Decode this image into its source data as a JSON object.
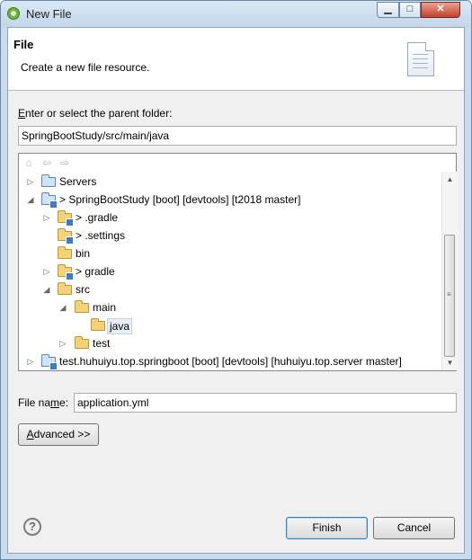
{
  "window": {
    "title": "New File",
    "controls": {
      "minimize": "▁",
      "maximize": "□",
      "close": "✕"
    }
  },
  "banner": {
    "title": "File",
    "description": "Create a new file resource."
  },
  "parent_folder": {
    "label_mnemonic": "E",
    "label_rest": "nter or select the parent folder:",
    "value": "SpringBootStudy/src/main/java"
  },
  "tree": {
    "toolbar": {
      "home": "⌂",
      "back": "⇦",
      "forward": "⇨"
    },
    "rows": [
      {
        "text": "Servers",
        "expander": "▷",
        "kind": "project"
      },
      {
        "text": "> SpringBootStudy [boot] [devtools] [t2018 master]",
        "expander": "◢",
        "kind": "project"
      },
      {
        "text": "> .gradle",
        "expander": "▷",
        "kind": "folder"
      },
      {
        "text": "> .settings",
        "expander": "",
        "kind": "folder"
      },
      {
        "text": "bin",
        "expander": "",
        "kind": "folder"
      },
      {
        "text": "> gradle",
        "expander": "▷",
        "kind": "folder"
      },
      {
        "text": "src",
        "expander": "◢",
        "kind": "folder"
      },
      {
        "text": "main",
        "expander": "◢",
        "kind": "folder"
      },
      {
        "text": "java",
        "expander": "",
        "kind": "folder",
        "selected": true
      },
      {
        "text": "test",
        "expander": "▷",
        "kind": "folder"
      },
      {
        "text": "test.huhuiyu.top.springboot [boot] [devtools] [huhuiyu.top.server master]",
        "expander": "▷",
        "kind": "project"
      }
    ],
    "scroll": {
      "up": "▲",
      "down": "▼",
      "grip": "≡"
    }
  },
  "file_name": {
    "label_before": "File na",
    "label_mnemonic": "m",
    "label_after": "e:",
    "value": "application.yml"
  },
  "advanced": {
    "mnemonic": "A",
    "rest": "dvanced >>"
  },
  "help": {
    "glyph": "?"
  },
  "buttons": {
    "finish": "Finish",
    "cancel": "Cancel"
  }
}
